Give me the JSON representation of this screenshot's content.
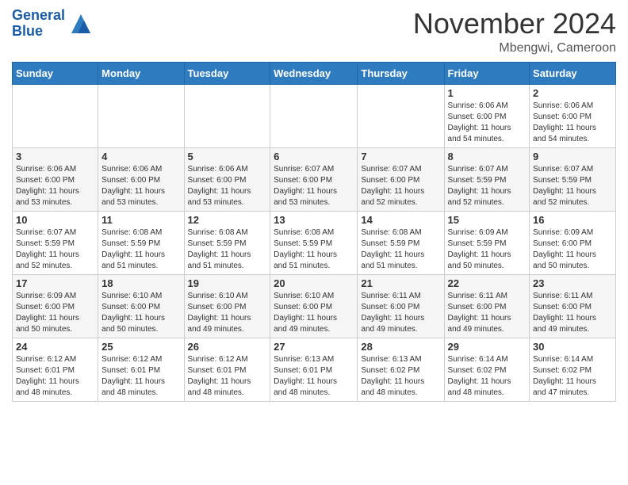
{
  "header": {
    "logo_line1": "General",
    "logo_line2": "Blue",
    "month": "November 2024",
    "location": "Mbengwi, Cameroon"
  },
  "weekdays": [
    "Sunday",
    "Monday",
    "Tuesday",
    "Wednesday",
    "Thursday",
    "Friday",
    "Saturday"
  ],
  "weeks": [
    [
      {
        "day": "",
        "info": ""
      },
      {
        "day": "",
        "info": ""
      },
      {
        "day": "",
        "info": ""
      },
      {
        "day": "",
        "info": ""
      },
      {
        "day": "",
        "info": ""
      },
      {
        "day": "1",
        "info": "Sunrise: 6:06 AM\nSunset: 6:00 PM\nDaylight: 11 hours\nand 54 minutes."
      },
      {
        "day": "2",
        "info": "Sunrise: 6:06 AM\nSunset: 6:00 PM\nDaylight: 11 hours\nand 54 minutes."
      }
    ],
    [
      {
        "day": "3",
        "info": "Sunrise: 6:06 AM\nSunset: 6:00 PM\nDaylight: 11 hours\nand 53 minutes."
      },
      {
        "day": "4",
        "info": "Sunrise: 6:06 AM\nSunset: 6:00 PM\nDaylight: 11 hours\nand 53 minutes."
      },
      {
        "day": "5",
        "info": "Sunrise: 6:06 AM\nSunset: 6:00 PM\nDaylight: 11 hours\nand 53 minutes."
      },
      {
        "day": "6",
        "info": "Sunrise: 6:07 AM\nSunset: 6:00 PM\nDaylight: 11 hours\nand 53 minutes."
      },
      {
        "day": "7",
        "info": "Sunrise: 6:07 AM\nSunset: 6:00 PM\nDaylight: 11 hours\nand 52 minutes."
      },
      {
        "day": "8",
        "info": "Sunrise: 6:07 AM\nSunset: 5:59 PM\nDaylight: 11 hours\nand 52 minutes."
      },
      {
        "day": "9",
        "info": "Sunrise: 6:07 AM\nSunset: 5:59 PM\nDaylight: 11 hours\nand 52 minutes."
      }
    ],
    [
      {
        "day": "10",
        "info": "Sunrise: 6:07 AM\nSunset: 5:59 PM\nDaylight: 11 hours\nand 52 minutes."
      },
      {
        "day": "11",
        "info": "Sunrise: 6:08 AM\nSunset: 5:59 PM\nDaylight: 11 hours\nand 51 minutes."
      },
      {
        "day": "12",
        "info": "Sunrise: 6:08 AM\nSunset: 5:59 PM\nDaylight: 11 hours\nand 51 minutes."
      },
      {
        "day": "13",
        "info": "Sunrise: 6:08 AM\nSunset: 5:59 PM\nDaylight: 11 hours\nand 51 minutes."
      },
      {
        "day": "14",
        "info": "Sunrise: 6:08 AM\nSunset: 5:59 PM\nDaylight: 11 hours\nand 51 minutes."
      },
      {
        "day": "15",
        "info": "Sunrise: 6:09 AM\nSunset: 5:59 PM\nDaylight: 11 hours\nand 50 minutes."
      },
      {
        "day": "16",
        "info": "Sunrise: 6:09 AM\nSunset: 6:00 PM\nDaylight: 11 hours\nand 50 minutes."
      }
    ],
    [
      {
        "day": "17",
        "info": "Sunrise: 6:09 AM\nSunset: 6:00 PM\nDaylight: 11 hours\nand 50 minutes."
      },
      {
        "day": "18",
        "info": "Sunrise: 6:10 AM\nSunset: 6:00 PM\nDaylight: 11 hours\nand 50 minutes."
      },
      {
        "day": "19",
        "info": "Sunrise: 6:10 AM\nSunset: 6:00 PM\nDaylight: 11 hours\nand 49 minutes."
      },
      {
        "day": "20",
        "info": "Sunrise: 6:10 AM\nSunset: 6:00 PM\nDaylight: 11 hours\nand 49 minutes."
      },
      {
        "day": "21",
        "info": "Sunrise: 6:11 AM\nSunset: 6:00 PM\nDaylight: 11 hours\nand 49 minutes."
      },
      {
        "day": "22",
        "info": "Sunrise: 6:11 AM\nSunset: 6:00 PM\nDaylight: 11 hours\nand 49 minutes."
      },
      {
        "day": "23",
        "info": "Sunrise: 6:11 AM\nSunset: 6:00 PM\nDaylight: 11 hours\nand 49 minutes."
      }
    ],
    [
      {
        "day": "24",
        "info": "Sunrise: 6:12 AM\nSunset: 6:01 PM\nDaylight: 11 hours\nand 48 minutes."
      },
      {
        "day": "25",
        "info": "Sunrise: 6:12 AM\nSunset: 6:01 PM\nDaylight: 11 hours\nand 48 minutes."
      },
      {
        "day": "26",
        "info": "Sunrise: 6:12 AM\nSunset: 6:01 PM\nDaylight: 11 hours\nand 48 minutes."
      },
      {
        "day": "27",
        "info": "Sunrise: 6:13 AM\nSunset: 6:01 PM\nDaylight: 11 hours\nand 48 minutes."
      },
      {
        "day": "28",
        "info": "Sunrise: 6:13 AM\nSunset: 6:02 PM\nDaylight: 11 hours\nand 48 minutes."
      },
      {
        "day": "29",
        "info": "Sunrise: 6:14 AM\nSunset: 6:02 PM\nDaylight: 11 hours\nand 48 minutes."
      },
      {
        "day": "30",
        "info": "Sunrise: 6:14 AM\nSunset: 6:02 PM\nDaylight: 11 hours\nand 47 minutes."
      }
    ]
  ]
}
